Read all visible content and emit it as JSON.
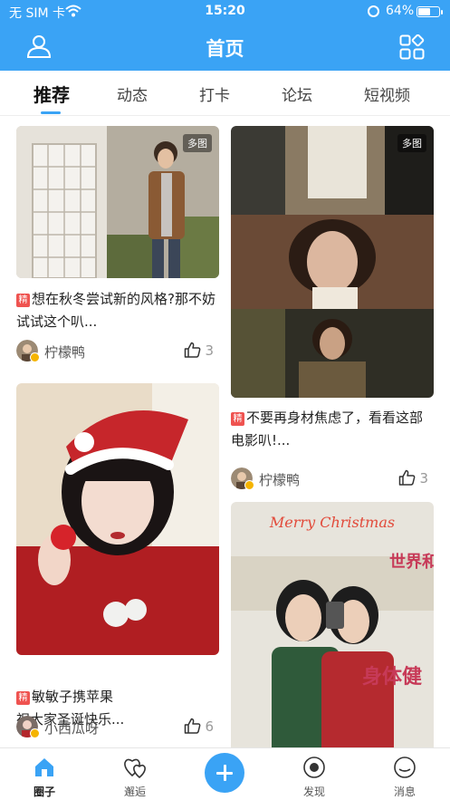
{
  "status_bar": {
    "carrier": "无 SIM 卡",
    "time": "15:20",
    "battery_percent": "64%",
    "battery_level": 0.64
  },
  "header": {
    "title": "首页"
  },
  "tabs": [
    {
      "label": "推荐",
      "active": true
    },
    {
      "label": "动态",
      "active": false
    },
    {
      "label": "打卡",
      "active": false
    },
    {
      "label": "论坛",
      "active": false
    },
    {
      "label": "短视频",
      "active": false
    }
  ],
  "posts": [
    {
      "badge": "多图",
      "featured_mark": "精",
      "title": "想在秋冬尝试新的风格?那不妨试试这个叭...",
      "author": "柠檬鸭",
      "likes": "3"
    },
    {
      "badge": "多图",
      "featured_mark": "精",
      "title": "不要再身材焦虑了，看看这部电影叭!...",
      "author": "柠檬鸭",
      "likes": "3"
    },
    {
      "featured_mark": "精",
      "title": "敏敏子携苹果\n祝大家圣诞快乐...",
      "author": "小西瓜呀",
      "likes": "6"
    },
    {
      "image_text_1": "Merry Christmas",
      "image_text_2": "世界和",
      "image_text_3": "身体健"
    }
  ],
  "tabbar": [
    {
      "label": "圈子",
      "icon": "home-icon",
      "active": true
    },
    {
      "label": "邂逅",
      "icon": "hearts-icon",
      "active": false
    },
    {
      "label": "",
      "icon": "plus-icon",
      "active": false
    },
    {
      "label": "发现",
      "icon": "compass-icon",
      "active": false
    },
    {
      "label": "消息",
      "icon": "chat-icon",
      "active": false
    }
  ],
  "colors": {
    "brand": "#3aa3f5",
    "featured": "#ef5350"
  }
}
